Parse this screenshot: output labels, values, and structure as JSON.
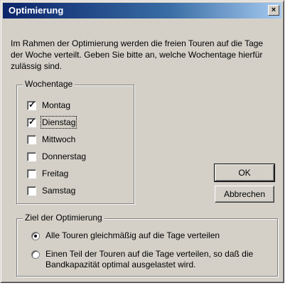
{
  "window": {
    "title": "Optimierung",
    "close_label": "×"
  },
  "description": "Im Rahmen der Optimierung werden die freien Touren auf die Tage der Woche verteilt. Geben Sie bitte an, welche Wochentage hierfür zulässig sind.",
  "weekdays": {
    "legend": "Wochentage",
    "items": [
      {
        "label": "Montag",
        "checked": true
      },
      {
        "label": "Dienstag",
        "checked": true
      },
      {
        "label": "Mittwoch",
        "checked": false
      },
      {
        "label": "Donnerstag",
        "checked": false
      },
      {
        "label": "Freitag",
        "checked": false
      },
      {
        "label": "Samstag",
        "checked": false
      }
    ]
  },
  "buttons": {
    "ok_label": "OK",
    "cancel_label": "Abbrechen"
  },
  "goal": {
    "legend": "Ziel der Optimierung",
    "options": [
      {
        "label": "Alle Touren gleichmäßig auf die Tage verteilen",
        "selected": true
      },
      {
        "label": "Einen Teil der Touren auf die Tage verteilen, so daß die Bandkapazität optimal ausgelastet wird.",
        "selected": false
      }
    ]
  },
  "colors": {
    "titlebar_start": "#0a246a",
    "dialog_face": "#d4d0c8"
  }
}
